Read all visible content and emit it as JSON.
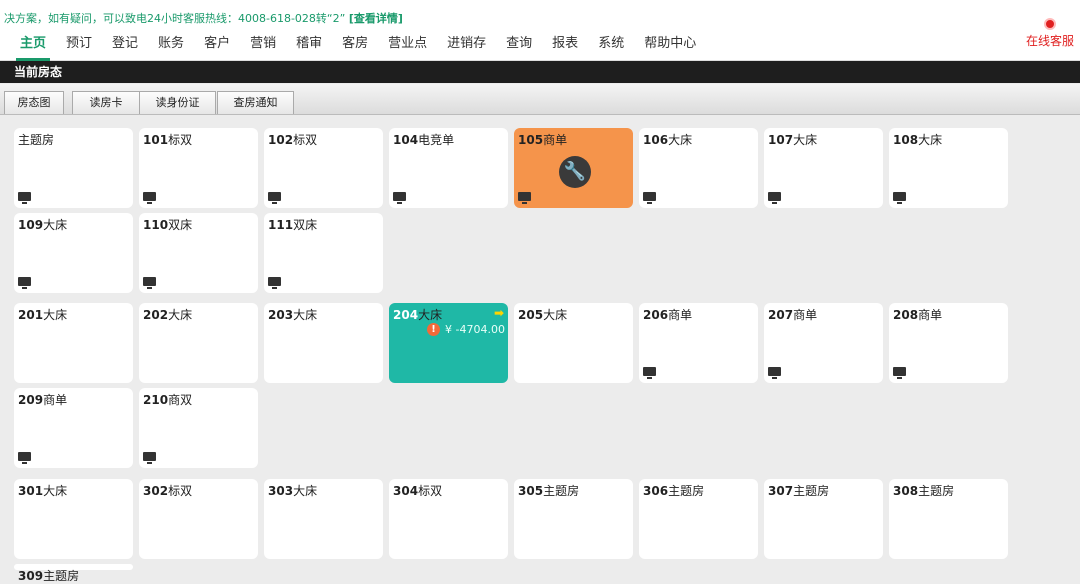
{
  "header": {
    "notice_text": "决方案，如有疑问，可以致电24小时客服热线：4008-618-028转“2”",
    "notice_link": "[查看详情]",
    "service_label": "在线客服",
    "nav": [
      "主页",
      "预订",
      "登记",
      "账务",
      "客户",
      "营销",
      "稽审",
      "客房",
      "营业点",
      "进销存",
      "查询",
      "报表",
      "系统",
      "帮助中心"
    ]
  },
  "section_title": "当前房态",
  "tabs": [
    "房态图",
    "读房卡",
    "读身份证",
    "查房通知"
  ],
  "rooms": [
    {
      "num": "",
      "label": "主题房",
      "tv": true
    },
    {
      "num": "101",
      "label": "标双",
      "tv": true
    },
    {
      "num": "102",
      "label": "标双",
      "tv": true
    },
    {
      "num": "104",
      "label": "电竞单",
      "tv": true
    },
    {
      "num": "105",
      "label": "商单",
      "tv": true,
      "status": "maintenance"
    },
    {
      "num": "106",
      "label": "大床",
      "tv": true
    },
    {
      "num": "107",
      "label": "大床",
      "tv": true
    },
    {
      "num": "108",
      "label": "大床",
      "tv": true
    },
    {
      "num": "109",
      "label": "大床",
      "tv": true
    },
    {
      "num": "110",
      "label": "双床",
      "tv": true
    },
    {
      "num": "111",
      "label": "双床",
      "tv": true
    },
    {
      "num": "201",
      "label": "大床",
      "tv": false
    },
    {
      "num": "202",
      "label": "大床",
      "tv": false
    },
    {
      "num": "203",
      "label": "大床",
      "tv": false
    },
    {
      "num": "204",
      "label": "大床",
      "tv": false,
      "status": "occupied",
      "balance": "¥ -4704.00"
    },
    {
      "num": "205",
      "label": "大床",
      "tv": false
    },
    {
      "num": "206",
      "label": "商单",
      "tv": true
    },
    {
      "num": "207",
      "label": "商单",
      "tv": true
    },
    {
      "num": "208",
      "label": "商单",
      "tv": true
    },
    {
      "num": "209",
      "label": "商单",
      "tv": true
    },
    {
      "num": "210",
      "label": "商双",
      "tv": true
    },
    {
      "num": "301",
      "label": "大床",
      "tv": false
    },
    {
      "num": "302",
      "label": "标双",
      "tv": false
    },
    {
      "num": "303",
      "label": "大床",
      "tv": false
    },
    {
      "num": "304",
      "label": "标双",
      "tv": false
    },
    {
      "num": "305",
      "label": "主题房",
      "tv": false
    },
    {
      "num": "306",
      "label": "主题房",
      "tv": false
    },
    {
      "num": "307",
      "label": "主题房",
      "tv": false
    },
    {
      "num": "308",
      "label": "主题房",
      "tv": false
    },
    {
      "num": "309",
      "label": "主题房",
      "tv": false
    }
  ],
  "colors": {
    "accent": "#1a9a6b",
    "maintenance": "#f5944b",
    "occupied": "#1fb8a6",
    "service": "#e02020"
  }
}
